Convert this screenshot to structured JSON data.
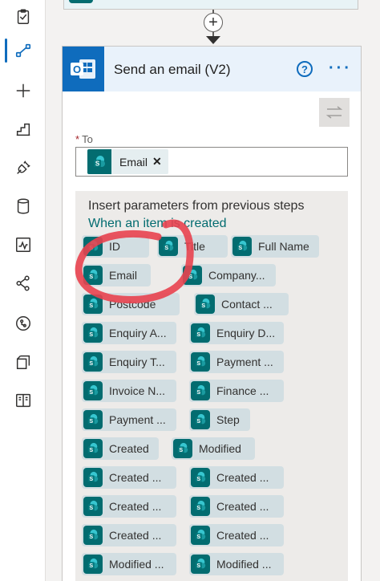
{
  "card": {
    "title": "Send an email (V2)",
    "help_glyph": "?",
    "more_glyph": "···"
  },
  "to_field": {
    "label": "To",
    "required_marker": "*",
    "token_label": "Email",
    "remove_glyph": "✕"
  },
  "dynamic_content": {
    "title": "Insert parameters from previous steps",
    "source": "When an item is created",
    "chips": [
      "ID",
      "Title",
      "Full Name",
      "Email",
      "Company...",
      "Postcode",
      "Contact ...",
      "Enquiry A...",
      "Enquiry D...",
      "Enquiry T...",
      "Payment ...",
      "Invoice N...",
      "Finance ...",
      "Payment ...",
      "Step",
      "Created",
      "Modified",
      "Created ...",
      "Created ...",
      "Created ...",
      "Created ...",
      "Created ...",
      "Created ...",
      "Modified ...",
      "Modified ..."
    ]
  },
  "annotation": {
    "color": "#e8434f",
    "shape": "hand-drawn-circle-around-email-chip"
  },
  "colors": {
    "accent": "#0f6cbd",
    "sharepoint": "#036c70",
    "required": "#a4262c"
  },
  "rail_icons": [
    "clipboard-icon",
    "flow-icon",
    "add-icon",
    "step-chart-icon",
    "connector-plug-icon",
    "database-icon",
    "monitor-chart-icon",
    "ai-network-icon",
    "process-advisor-icon",
    "template-icon",
    "learn-book-icon"
  ]
}
